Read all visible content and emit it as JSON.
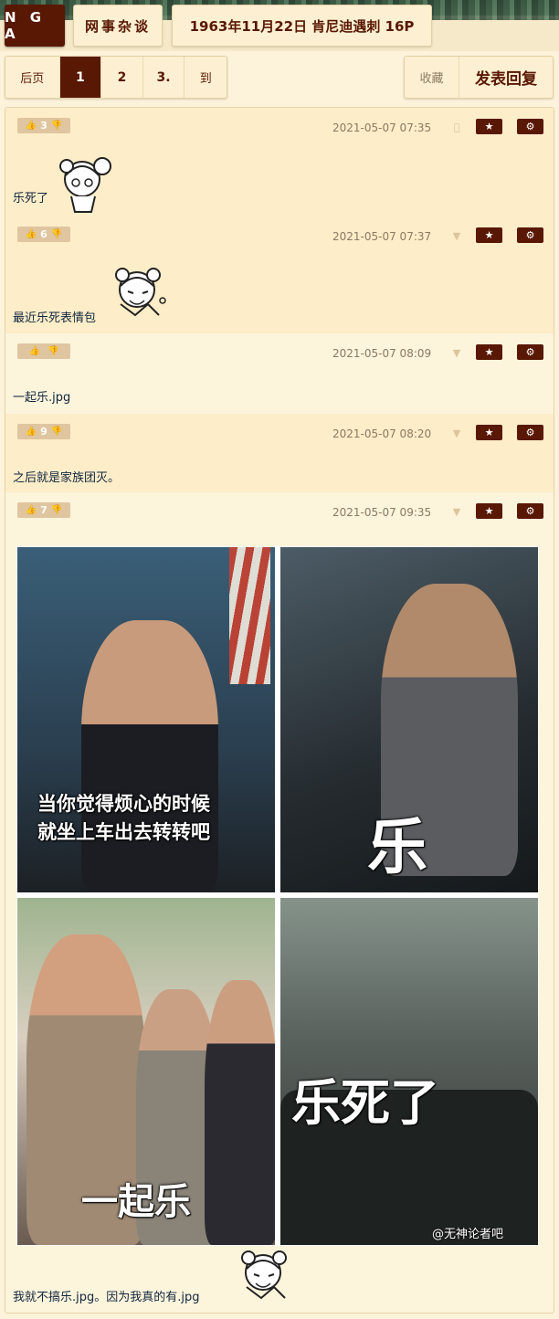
{
  "header": {
    "logo": "N G A",
    "forum": "网事杂谈",
    "topic": "1963年11月22日 肯尼迪遇刺 16P"
  },
  "pager": {
    "prev": "后页",
    "pages": [
      "1",
      "2",
      "3."
    ],
    "current": "1",
    "goto": "到"
  },
  "actions": {
    "favorite": "收藏",
    "reply": "发表回复"
  },
  "icons": {
    "thumb_up": "thumb-up-icon",
    "thumb_down": "thumb-down-icon",
    "star": "star-icon",
    "gear": "gear-icon",
    "apple": "apple-icon",
    "android": "android-icon"
  },
  "colors": {
    "accent": "#591804",
    "background": "#fdf3da",
    "post_alt": "#fdedc8",
    "vote_bg": "#dfc6a0"
  },
  "posts": [
    {
      "votes": "3",
      "time": "2021-05-07 07:35",
      "device": "apple",
      "text": "乐死了"
    },
    {
      "votes": "6",
      "time": "2021-05-07 07:37",
      "device": "android",
      "text": "最近乐死表情包"
    },
    {
      "votes": "",
      "time": "2021-05-07 08:09",
      "device": "android",
      "text": "一起乐.jpg"
    },
    {
      "votes": "9",
      "time": "2021-05-07 08:20",
      "device": "android",
      "text": "之后就是家族团灭。"
    },
    {
      "votes": "7",
      "time": "2021-05-07 09:35",
      "device": "android",
      "text": "我就不搞乐.jpg。因为我真的有.jpg",
      "image_captions": [
        "当你觉得烦心的时候",
        "就坐上车出去转转吧",
        "乐",
        "一起乐",
        "乐死了"
      ],
      "watermark": "@无神论者吧"
    }
  ]
}
